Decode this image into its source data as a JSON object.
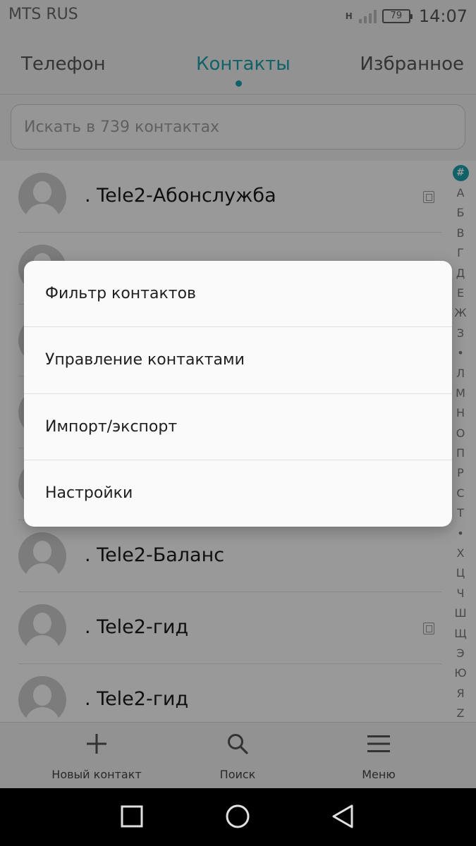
{
  "status_bar": {
    "carrier": "MTS RUS",
    "network_type": "H",
    "battery": "79",
    "time": "14:07"
  },
  "tabs": [
    {
      "label": "Телефон",
      "active": false
    },
    {
      "label": "Контакты",
      "active": true
    },
    {
      "label": "Избранное",
      "active": false
    }
  ],
  "search": {
    "placeholder": "Искать в 739 контактах"
  },
  "contacts": [
    {
      "name": ". Tele2-Абонслужба",
      "sim_icon": true
    },
    {
      "name": "",
      "sim_icon": false
    },
    {
      "name": "",
      "sim_icon": false
    },
    {
      "name": "",
      "sim_icon": false
    },
    {
      "name": "",
      "sim_icon": false
    },
    {
      "name": ". Tele2-Баланс",
      "sim_icon": false
    },
    {
      "name": ". Tele2-гид",
      "sim_icon": true
    },
    {
      "name": ". Tele2-гид",
      "sim_icon": false
    }
  ],
  "index_letters": [
    "#",
    "А",
    "Б",
    "В",
    "Г",
    "Д",
    "Е",
    "Ж",
    "З",
    "•",
    "Л",
    "М",
    "Н",
    "О",
    "П",
    "Р",
    "С",
    "Т",
    "•",
    "Х",
    "Ц",
    "Ч",
    "Ш",
    "Щ",
    "Э",
    "Ю",
    "Я",
    "Z"
  ],
  "menu": {
    "items": [
      "Фильтр контактов",
      "Управление контактами",
      "Импорт/экспорт",
      "Настройки"
    ]
  },
  "toolbar": {
    "new_contact_label": "Новый контакт",
    "search_label": "Поиск",
    "menu_label": "Меню"
  },
  "colors": {
    "accent": "#1da4ad",
    "scrim": "rgba(0,0,0,0.40)"
  }
}
